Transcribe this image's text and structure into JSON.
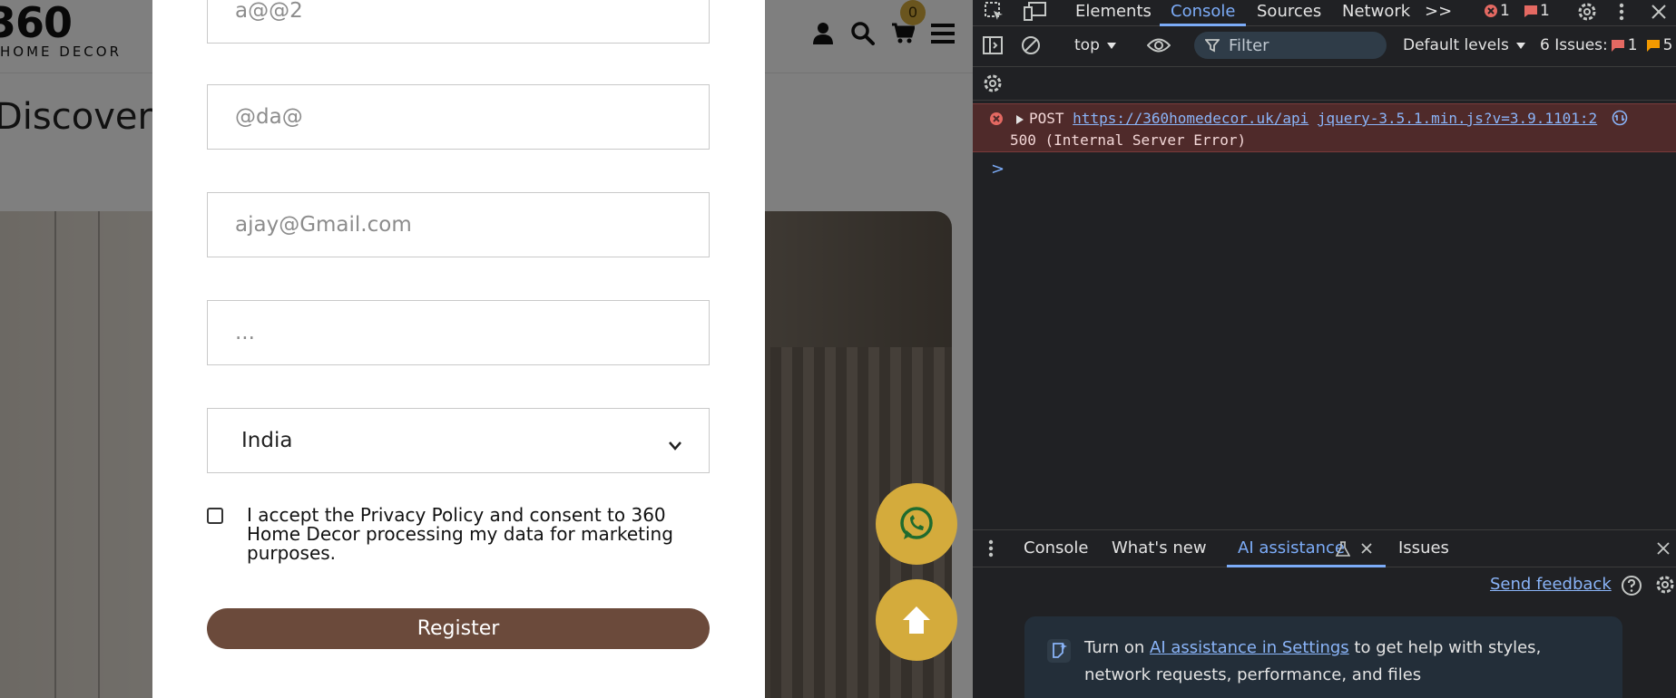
{
  "site": {
    "logo_top": "360",
    "logo_bottom": "HOME DECOR",
    "cart_count": "0",
    "hero_title": "Discover Luxury Furnishing & Decor"
  },
  "form": {
    "field1_value": "a@@2",
    "field2_value": "@da@",
    "field3_value": "ajay@Gmail.com",
    "field4_value": "...",
    "country_selected": "India",
    "consent_text": "I accept the Privacy Policy and consent to 360 Home Decor processing my data for marketing purposes.",
    "register_label": "Register"
  },
  "devtools": {
    "tabs": [
      "Elements",
      "Console",
      "Sources",
      "Network"
    ],
    "more_tabs": ">>",
    "error_count": "1",
    "issue_count_top": "1",
    "context": "top",
    "filter_placeholder": "Filter",
    "levels": "Default levels",
    "issues_label": "6 Issues:",
    "issues_errors": "1",
    "issues_warnings": "5",
    "error": {
      "method": "POST",
      "url": "https://360homedecor.uk/api",
      "source": "jquery-3.5.1.min.js?v=3.9.1101:2",
      "status": "500 (Internal Server Error)"
    },
    "prompt": ">",
    "drawer_tabs": [
      "Console",
      "What's new",
      "AI assistance",
      "Issues"
    ],
    "send_feedback": "Send feedback",
    "ai_card": {
      "prefix": "Turn on ",
      "link": "AI assistance in Settings",
      "suffix": " to get help with styles, network requests, performance, and files"
    }
  },
  "colors": {
    "accent_gold": "#d4ab3c",
    "register_brown": "#6b4a3b",
    "devtools_accent": "#7cacf8",
    "error_bg": "#4f2a2a"
  }
}
